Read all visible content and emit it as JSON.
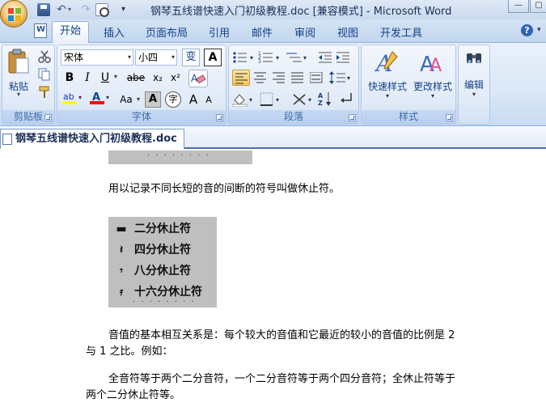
{
  "window": {
    "title": "钢琴五线谱快速入门初级教程.doc [兼容模式] - Microsoft Word",
    "min_label": "—",
    "max_label": "▢"
  },
  "qat": {
    "undo_glyph": "↶",
    "redo_glyph": "↷",
    "dropdown_glyph": "▾",
    "customize_glyph": "▾"
  },
  "ribbon_tabs": [
    "开始",
    "插入",
    "页面布局",
    "引用",
    "邮件",
    "审阅",
    "视图",
    "开发工具"
  ],
  "ribbon_help": "?",
  "clipboard": {
    "label": "剪贴板",
    "paste": "粘贴"
  },
  "font": {
    "label": "字体",
    "family": "宋体",
    "size": "小四",
    "bold": "B",
    "italic": "I",
    "underline": "U",
    "strike": "abe",
    "subscript": "x₂",
    "superscript": "x²",
    "case": "Aa",
    "grow": "A",
    "shrink": "A",
    "char_border": "A",
    "phonetic": "变",
    "enclose": "字"
  },
  "paragraph": {
    "label": "段落"
  },
  "styles": {
    "label": "样式",
    "quick": "快速样式",
    "change": "更改样式"
  },
  "edit": {
    "label": "编辑"
  },
  "document": {
    "tab": "钢琴五线谱快速入门初级教程.doc",
    "dots_top": "· · · · · · · ·",
    "line1": "用以记录不同长短的音的间断的符号叫做休止符。",
    "rests": [
      {
        "symbol": "▬",
        "label": "二分休止符"
      },
      {
        "symbol": "𝄽",
        "label": "四分休止符"
      },
      {
        "symbol": "𝄾",
        "label": "八分休止符"
      },
      {
        "symbol": "𝄿",
        "label": "十六分休止符"
      }
    ],
    "dots_bottom": "· · · · · · · ·",
    "line2a": "音值的基本相互关系是：每个较大的音值和它最近的较小的音值的比例是 2",
    "line2b": "与 1 之比。例如：",
    "line3a": "全音符等于两个二分音符，一个二分音符等于两个四分音符；全休止符等于",
    "line3b": "两个二分休止符等。"
  },
  "colors": {
    "highlight": "#ffff00",
    "font_color": "#ff0000",
    "accent": "#15428b"
  }
}
